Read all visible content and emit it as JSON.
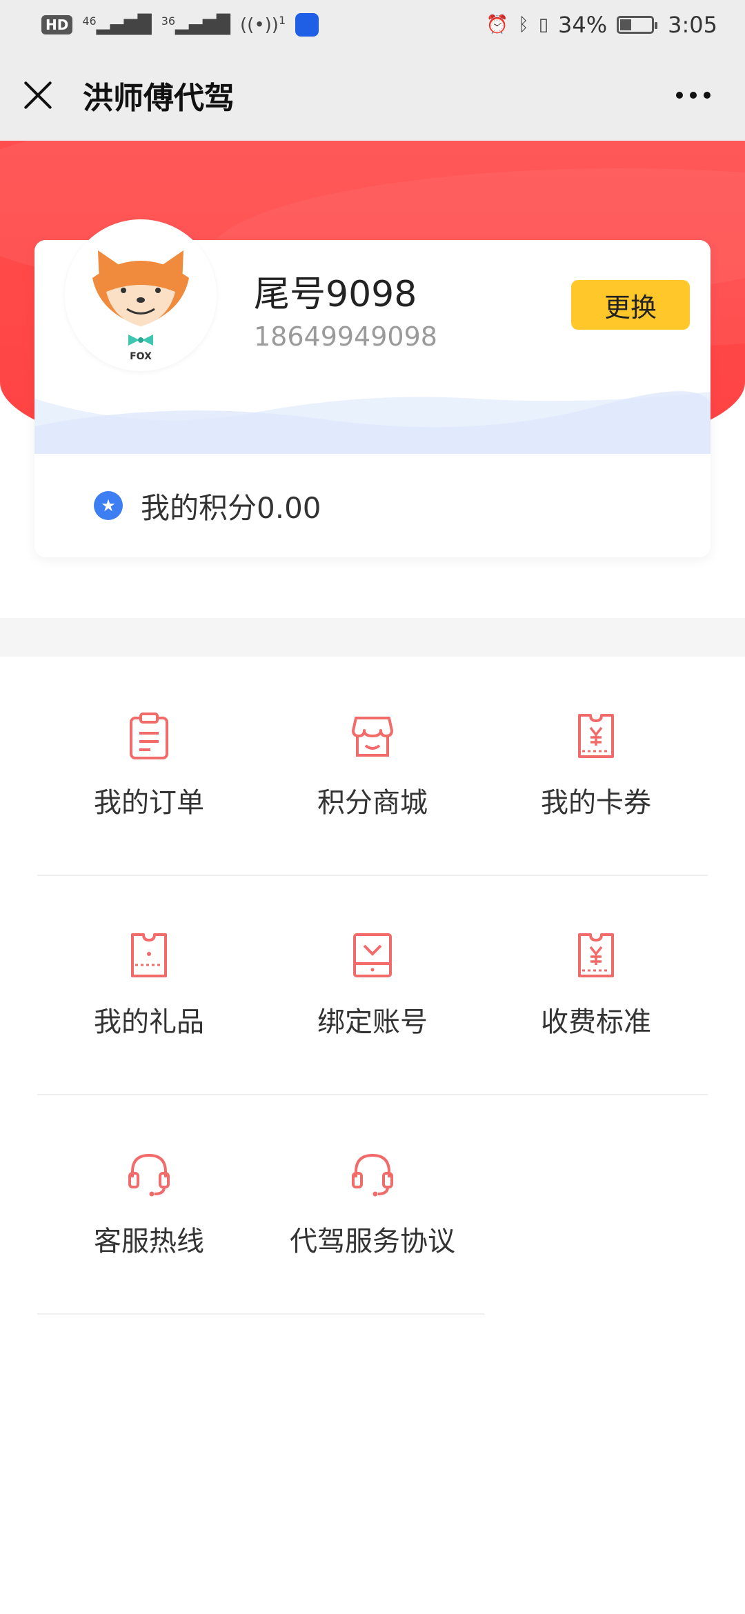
{
  "status_bar": {
    "left_labels": [
      "HD",
      "46",
      "36",
      "1"
    ],
    "battery": "34%",
    "time": "3:05"
  },
  "nav": {
    "title": "洪师傅代驾"
  },
  "profile": {
    "name": "尾号9098",
    "phone": "18649949098",
    "change_label": "更换",
    "avatar_caption": "FOX"
  },
  "points": {
    "label": "我的积分0.00"
  },
  "menu": {
    "rows": [
      [
        {
          "label": "我的订单",
          "icon": "clipboard-icon"
        },
        {
          "label": "积分商城",
          "icon": "shop-icon"
        },
        {
          "label": "我的卡券",
          "icon": "coupon-icon"
        }
      ],
      [
        {
          "label": "我的礼品",
          "icon": "gift-ticket-icon"
        },
        {
          "label": "绑定账号",
          "icon": "bind-account-icon"
        },
        {
          "label": "收费标准",
          "icon": "fee-icon"
        }
      ],
      [
        {
          "label": "客服热线",
          "icon": "headset-icon"
        },
        {
          "label": "代驾服务协议",
          "icon": "headset-icon"
        }
      ]
    ]
  },
  "colors": {
    "accent_red": "#ff4a4a",
    "icon_red": "#f26b6b",
    "button_yellow": "#ffc72a",
    "points_blue": "#3d7ff2"
  }
}
